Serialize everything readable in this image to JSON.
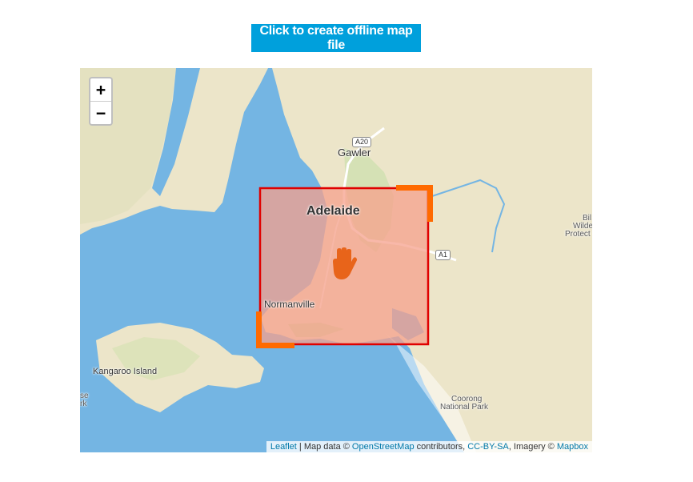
{
  "toolbar": {
    "create_label": "Click to create offline map file"
  },
  "map": {
    "zoom_in": "+",
    "zoom_out": "−",
    "places": {
      "adelaide": "Adelaide",
      "gawler": "Gawler",
      "normanville": "Normanville",
      "kangaroo_island": "Kangaroo Island",
      "coorong_1": "Coorong",
      "coorong_2": "National Park",
      "bil": "Bil",
      "wilde": "Wilde",
      "protect": "Protect",
      "se": "se",
      "rk": "rk"
    },
    "roads": {
      "a20": "A20",
      "a1": "A1"
    },
    "selection": {
      "icon": "hand-icon"
    },
    "colors": {
      "water": "#74b5e3",
      "land": "#ece5c9",
      "selection_fill": "#f5a08c",
      "selection_border": "#e00000",
      "handle": "#ff6a00",
      "button": "#00a0dc"
    },
    "attribution": {
      "leaflet": "Leaflet",
      "sep1": " | Map data © ",
      "osm": "OpenStreetMap",
      "contrib": " contributors, ",
      "license": "CC-BY-SA",
      "imagery": ", Imagery © ",
      "mapbox": "Mapbox"
    }
  }
}
